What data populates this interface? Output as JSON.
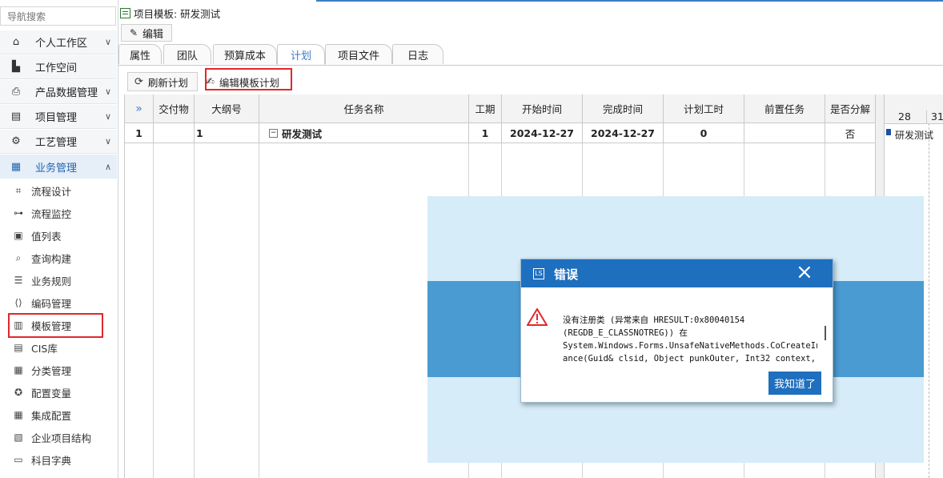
{
  "sidebar": {
    "search_placeholder": "导航搜索",
    "items": [
      {
        "label": "个人工作区",
        "icon": "home-icon",
        "chevron": "∨"
      },
      {
        "label": "工作空间",
        "icon": "building-icon",
        "chevron": ""
      },
      {
        "label": "产品数据管理",
        "icon": "printer-icon",
        "chevron": "∨"
      },
      {
        "label": "项目管理",
        "icon": "document-icon",
        "chevron": "∨"
      },
      {
        "label": "工艺管理",
        "icon": "gear-icon",
        "chevron": "∨"
      },
      {
        "label": "业务管理",
        "icon": "grid-icon",
        "chevron": "∧"
      }
    ],
    "subitems": [
      {
        "label": "流程设计",
        "icon": "frame-icon"
      },
      {
        "label": "流程监控",
        "icon": "flow-icon"
      },
      {
        "label": "值列表",
        "icon": "list-icon"
      },
      {
        "label": "查询构建",
        "icon": "search-icon"
      },
      {
        "label": "业务规则",
        "icon": "rules-icon"
      },
      {
        "label": "编码管理",
        "icon": "code-icon"
      },
      {
        "label": "模板管理",
        "icon": "template-icon"
      },
      {
        "label": "CIS库",
        "icon": "library-icon"
      },
      {
        "label": "分类管理",
        "icon": "table-icon"
      },
      {
        "label": "配置变量",
        "icon": "variable-icon"
      },
      {
        "label": "集成配置",
        "icon": "integration-icon"
      },
      {
        "label": "企业项目结构",
        "icon": "structure-icon"
      },
      {
        "label": "科目字典",
        "icon": "dictionary-icon"
      }
    ]
  },
  "header": {
    "title": "项目模板: 研发测试",
    "edit_label": "编辑"
  },
  "tabs": [
    "属性",
    "团队",
    "预算成本",
    "计划",
    "项目文件",
    "日志"
  ],
  "active_tab": "计划",
  "toolbar": {
    "refresh_label": "刷新计划",
    "edit_template_label": "编辑模板计划"
  },
  "grid": {
    "columns": [
      "",
      "交付物",
      "大纲号",
      "任务名称",
      "工期",
      "开始时间",
      "完成时间",
      "计划工时",
      "前置任务",
      "是否分解"
    ],
    "rows": [
      {
        "no": "1",
        "deliverable": "",
        "outline": "1",
        "task": "研发测试",
        "duration": "1",
        "start": "2024-12-27",
        "finish": "2024-12-27",
        "work": "0",
        "predecessor": "",
        "decompose": "否"
      }
    ]
  },
  "gantt": {
    "days": [
      "28",
      "31"
    ],
    "bar_label": "研发测试"
  },
  "dialog": {
    "title": "错误",
    "lines": [
      "没有注册类 (异常来自 HRESULT:0x80040154",
      "(REGDB_E_CLASSNOTREG))  在",
      "System.Windows.Forms.UnsafeNativeMethods.CoCreateInst",
      "ance(Guid& clsid, Object punkOuter, Int32 context,"
    ],
    "ok_label": "我知道了"
  },
  "colors": {
    "accent": "#1f6fbf",
    "highlight_box": "#e0282a",
    "overlay": "#d6ecf8",
    "overlay_band": "#4a9bd2"
  }
}
